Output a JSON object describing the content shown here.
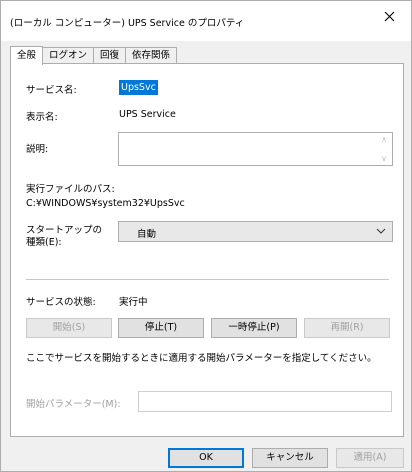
{
  "window": {
    "title": "(ローカル コンピューター) UPS Service のプロパティ",
    "close_icon": "close-icon"
  },
  "tabs": [
    {
      "label": "全般",
      "active": true
    },
    {
      "label": "ログオン",
      "active": false
    },
    {
      "label": "回復",
      "active": false
    },
    {
      "label": "依存関係",
      "active": false
    }
  ],
  "general": {
    "service_name_label": "サービス名:",
    "service_name_value": "UpsSvc",
    "display_name_label": "表示名:",
    "display_name_value": "UPS Service",
    "description_label": "説明:",
    "description_value": "",
    "exe_path_label": "実行ファイルのパス:",
    "exe_path_value": "C:¥WINDOWS¥system32¥UpsSvc",
    "startup_type_label_line1": "スタートアップの",
    "startup_type_label_line2": "種類(E):",
    "startup_type_value": "自動",
    "status_label": "サービスの状態:",
    "status_value": "実行中",
    "buttons": {
      "start": "開始(S)",
      "stop": "停止(T)",
      "pause": "一時停止(P)",
      "resume": "再開(R)"
    },
    "hint": "ここでサービスを開始するときに適用する開始パラメーターを指定してください。",
    "start_params_label": "開始パラメーター(M):",
    "start_params_value": ""
  },
  "footer": {
    "ok": "OK",
    "cancel": "キャンセル",
    "apply": "適用(A)"
  }
}
